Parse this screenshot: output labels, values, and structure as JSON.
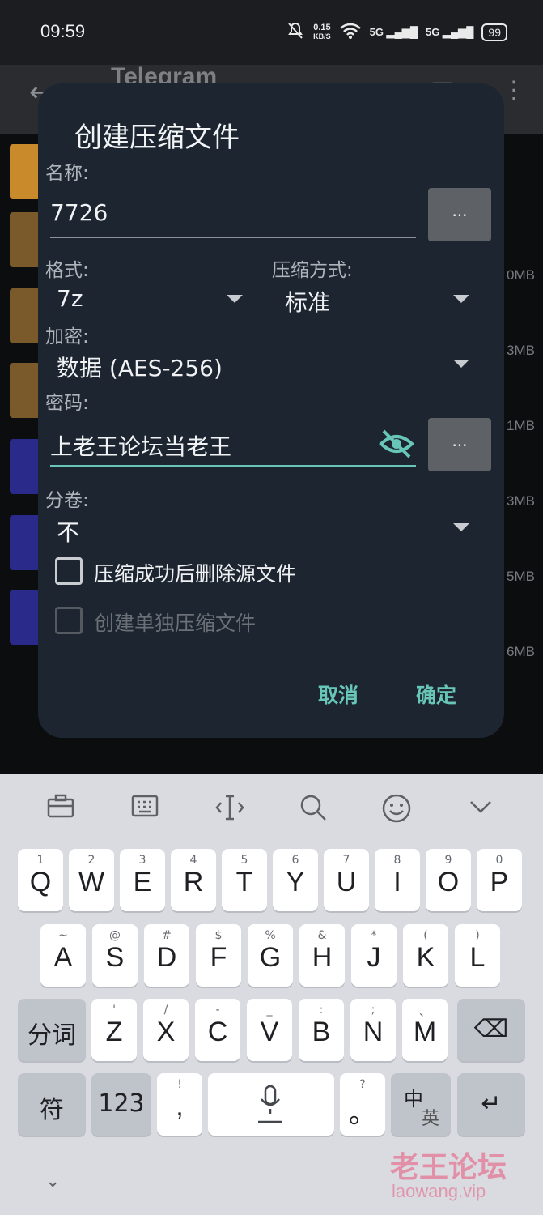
{
  "status": {
    "time": "09:59",
    "net_speed": "0.15",
    "net_unit": "KB/S",
    "signal1": "5G",
    "signal2": "5G",
    "battery": "99"
  },
  "background": {
    "title": "Telegram",
    "sizes": [
      "0MB",
      "3MB",
      "1MB",
      "3MB",
      "5MB",
      "6MB"
    ]
  },
  "dialog": {
    "title": "创建压缩文件",
    "name_label": "名称:",
    "name_value": "7726",
    "browse_label": "...",
    "format_label": "格式:",
    "format_value": "7z",
    "method_label": "压缩方式:",
    "method_value": "标准",
    "encrypt_label": "加密:",
    "encrypt_value": "数据 (AES-256)",
    "password_label": "密码:",
    "password_value": "上老王论坛当老王",
    "volume_label": "分卷:",
    "volume_value": "不",
    "delete_source_label": "压缩成功后删除源文件",
    "separate_label": "创建单独压缩文件",
    "cancel_label": "取消",
    "ok_label": "确定"
  },
  "keyboard": {
    "row1": [
      {
        "k": "Q",
        "h": "1"
      },
      {
        "k": "W",
        "h": "2"
      },
      {
        "k": "E",
        "h": "3"
      },
      {
        "k": "R",
        "h": "4"
      },
      {
        "k": "T",
        "h": "5"
      },
      {
        "k": "Y",
        "h": "6"
      },
      {
        "k": "U",
        "h": "7"
      },
      {
        "k": "I",
        "h": "8"
      },
      {
        "k": "O",
        "h": "9"
      },
      {
        "k": "P",
        "h": "0"
      }
    ],
    "row2": [
      {
        "k": "A",
        "h": "~"
      },
      {
        "k": "S",
        "h": "@"
      },
      {
        "k": "D",
        "h": "#"
      },
      {
        "k": "F",
        "h": "$"
      },
      {
        "k": "G",
        "h": "%"
      },
      {
        "k": "H",
        "h": "&"
      },
      {
        "k": "J",
        "h": "*"
      },
      {
        "k": "K",
        "h": "("
      },
      {
        "k": "L",
        "h": ")"
      }
    ],
    "row3": [
      {
        "k": "Z",
        "h": "'"
      },
      {
        "k": "X",
        "h": "/"
      },
      {
        "k": "C",
        "h": "-"
      },
      {
        "k": "V",
        "h": "_"
      },
      {
        "k": "B",
        "h": ":"
      },
      {
        "k": "N",
        "h": ";"
      },
      {
        "k": "M",
        "h": "、"
      }
    ],
    "fenci": "分词",
    "fu": "符",
    "num": "123",
    "comma": ",",
    "comma_hint": "!",
    "period": "。",
    "period_hint": "?",
    "lang_top": "中",
    "lang_bottom": "英",
    "enter": "↵",
    "backspace": "⌫"
  },
  "watermark": {
    "line1": "老王论坛",
    "line2": "laowang.vip"
  }
}
